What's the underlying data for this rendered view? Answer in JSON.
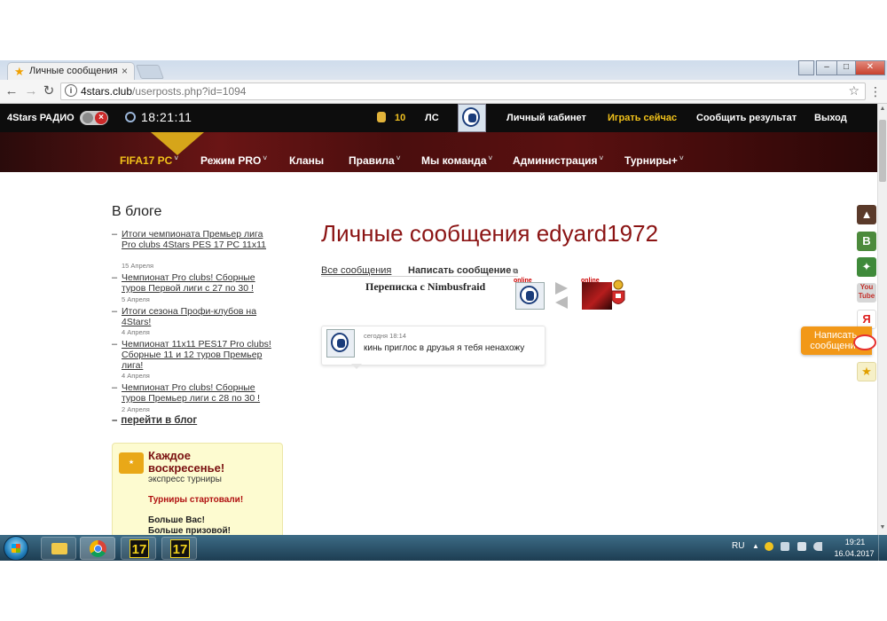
{
  "browser": {
    "tab_title": "Личные сообщения edy",
    "tab_close": "×",
    "url_host": "4stars.club",
    "url_path": "/userposts.php?id=1094",
    "window_min": "–",
    "window_max": "□",
    "window_close": "✕"
  },
  "topbar": {
    "radio_label": "4Stars РАДИО",
    "clock": "18:21:11",
    "coins": "10",
    "ls": "ЛС",
    "links": {
      "cabinet": "Личный кабинет",
      "play": "Играть сейчас",
      "report": "Сообщить результат",
      "exit": "Выход"
    }
  },
  "nav": {
    "fifa": "FIFA17 PC",
    "pro": "Режим PRO",
    "clans": "Кланы",
    "rules": "Правила",
    "we": "Мы команда",
    "admin": "Администрация",
    "tournaments": "Турниры+"
  },
  "sidebar": {
    "blog_title": "В блоге",
    "items": [
      {
        "title": "Итоги чемпионата Премьер лига Pro clubs 4Stars PES 17 PC 11x11",
        "date": "15 Апреля"
      },
      {
        "title": "Чемпионат Pro clubs! Сборные туров Первой лиги с 27 по 30 !",
        "date": "5 Апреля"
      },
      {
        "title": "Итоги сезона Профи-клубов на 4Stars!",
        "date": "4 Апреля"
      },
      {
        "title": "Чемпионат 11x11 PES17 Pro clubs! Сборные 11 и 12 туров Премьер лига!",
        "date": "4 Апреля"
      },
      {
        "title": "Чемпионат Pro clubs! Сборные туров Премьер лиги с 28 по 30 !",
        "date": "2 Апреля"
      }
    ],
    "more": "перейти в блог",
    "promo": {
      "title": "Каждое воскресенье!",
      "subtitle": "экспресс турниры",
      "started": "Турниры стартовали!",
      "more1": "Больше Вас!",
      "more2": "Больше призовой!"
    }
  },
  "main": {
    "title": "Личные сообщения edyard1972",
    "tab_all": "Все сообщения",
    "tab_write": "Написать сообщение",
    "conversation": "Переписка с Nimbusfraid",
    "online_label": "online",
    "message": {
      "time": "сегодня 18:14",
      "text": "кинь приглос в друзья я тебя ненахожу"
    }
  },
  "right_bar": {
    "vk": "В",
    "yandex": "Я",
    "youtube": "You Tube",
    "write_button": "Написать сообщение"
  },
  "taskbar": {
    "lang": "RU",
    "time": "19:21",
    "date": "16.04.2017",
    "fifa_label": "17"
  },
  "colors": {
    "accent_red": "#8b1414",
    "accent_yellow": "#f2c21a",
    "orange_button": "#f29818"
  },
  "icons": {
    "tab": "star-icon",
    "back": "arrow-left-icon",
    "forward": "arrow-right-icon",
    "reload": "reload-icon",
    "bookmark": "star-outline-icon"
  }
}
